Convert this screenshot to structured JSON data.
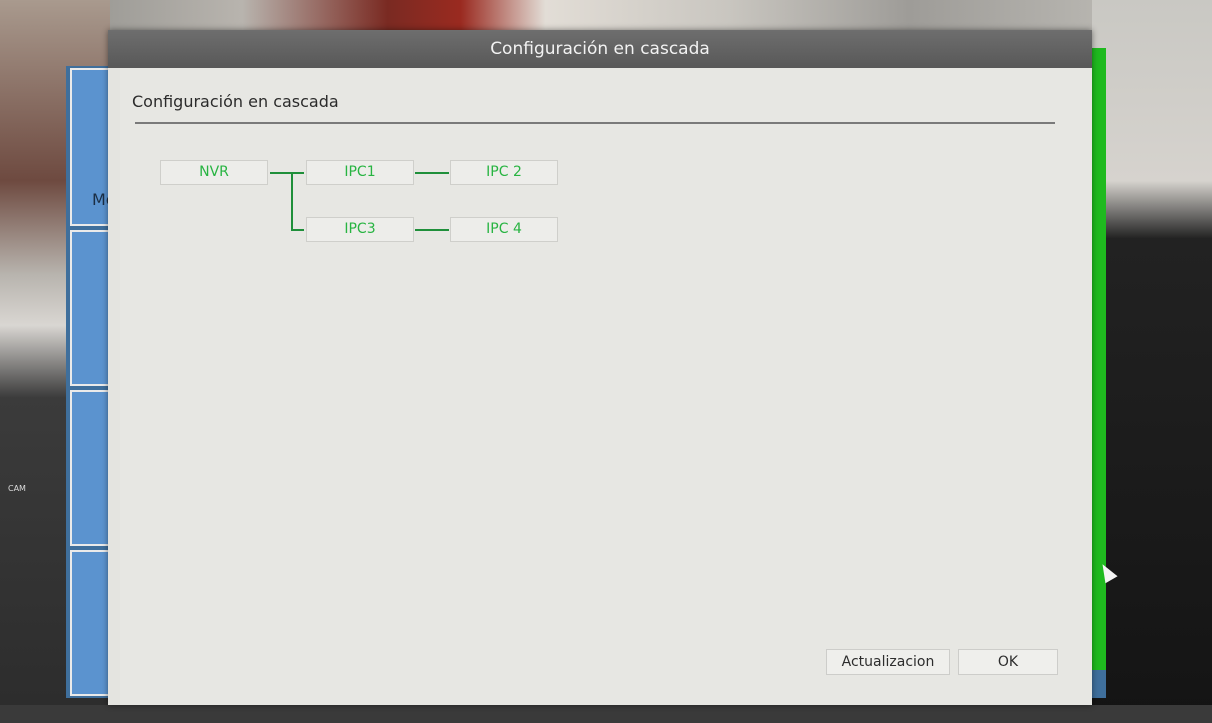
{
  "window": {
    "title": "Configuración en cascada"
  },
  "background": {
    "tile_label": "Me",
    "side_text": "CAM"
  },
  "section": {
    "title": "Configuración en cascada"
  },
  "topology": {
    "nodes": [
      {
        "id": "nvr",
        "label": "NVR"
      },
      {
        "id": "ipc1",
        "label": "IPC1"
      },
      {
        "id": "ipc2",
        "label": "IPC 2"
      },
      {
        "id": "ipc3",
        "label": "IPC3"
      },
      {
        "id": "ipc4",
        "label": "IPC 4"
      }
    ],
    "links": [
      [
        "nvr",
        "ipc1"
      ],
      [
        "nvr",
        "ipc3"
      ],
      [
        "ipc1",
        "ipc2"
      ],
      [
        "ipc3",
        "ipc4"
      ]
    ],
    "node_text_color": "#28b442",
    "link_color": "#1f8f3a"
  },
  "buttons": {
    "update": "Actualizacion",
    "ok": "OK"
  },
  "colors": {
    "accent_green": "#1fba1f",
    "titlebar": "#626262"
  }
}
